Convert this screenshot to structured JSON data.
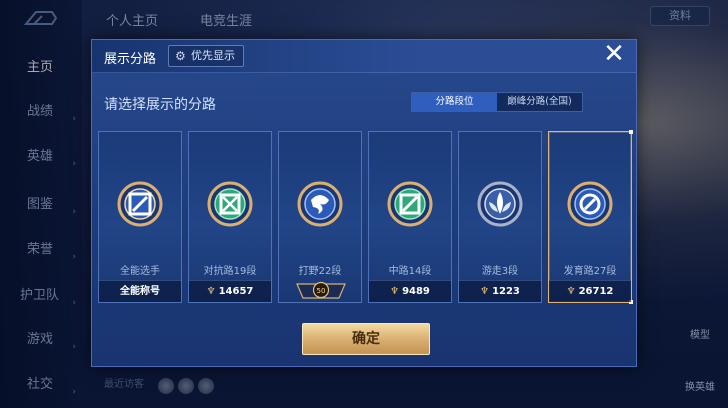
{
  "topnav": {
    "tab1": "个人主页",
    "tab2": "电竞生涯"
  },
  "sidebar": {
    "items": [
      {
        "label": "主页"
      },
      {
        "label": "战绩"
      },
      {
        "label": "英雄"
      },
      {
        "label": "图鉴"
      },
      {
        "label": "荣誉"
      },
      {
        "label": "护卫队"
      },
      {
        "label": "游戏"
      },
      {
        "label": "社交"
      }
    ]
  },
  "background": {
    "top_right": "资料",
    "bottom_hint": "最近访客",
    "right_btn_1": "模型",
    "right_btn_2": "换英雄"
  },
  "dialog": {
    "title": "展示分路",
    "priority_label": "优先显示",
    "close_symbol": "✕",
    "subtitle": "请选择展示的分路",
    "tabs": [
      {
        "label": "分路段位",
        "active": true
      },
      {
        "label": "巅峰分路(全国)",
        "active": false
      }
    ],
    "cards": [
      {
        "name": "全能选手",
        "value": "全能称号",
        "has_points": false,
        "selected": false,
        "icon": "all-round-badge"
      },
      {
        "name": "对抗路19段",
        "value": "14657",
        "has_points": true,
        "selected": false,
        "icon": "clash-lane-badge"
      },
      {
        "name": "打野22段",
        "value": "50",
        "has_points": false,
        "star_badge": true,
        "selected": false,
        "icon": "jungle-badge"
      },
      {
        "name": "中路14段",
        "value": "9489",
        "has_points": true,
        "selected": false,
        "icon": "mid-lane-badge"
      },
      {
        "name": "游走3段",
        "value": "1223",
        "has_points": true,
        "selected": false,
        "icon": "roam-badge"
      },
      {
        "name": "发育路27段",
        "value": "26712",
        "has_points": true,
        "selected": true,
        "icon": "farm-lane-badge"
      }
    ],
    "confirm_label": "确定"
  },
  "colors": {
    "accent": "#2f5fbe",
    "gold": "#d9b072",
    "selected_border": "#e0b574"
  }
}
